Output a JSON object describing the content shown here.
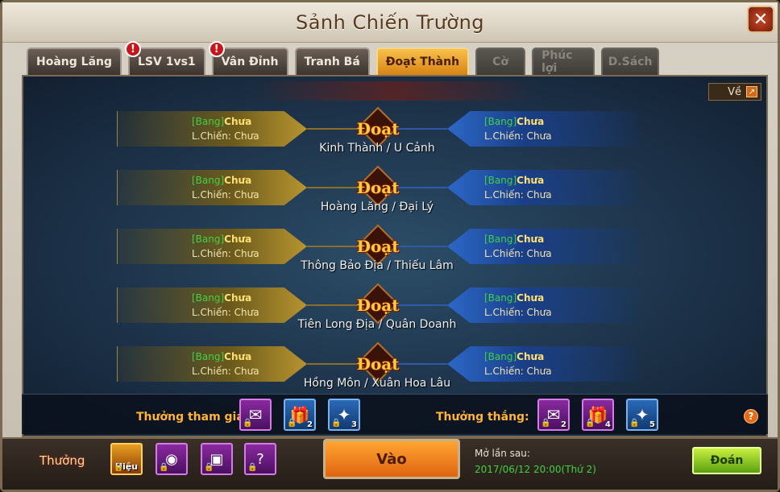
{
  "window": {
    "title": "Sảnh Chiến Trường",
    "close_glyph": "✕"
  },
  "tabs": [
    {
      "label": "Hoàng Lăng",
      "alert": false,
      "state": "normal"
    },
    {
      "label": "LSV 1vs1",
      "alert": true,
      "state": "normal"
    },
    {
      "label": "Vân Đỉnh",
      "alert": true,
      "state": "normal"
    },
    {
      "label": "Tranh Bá",
      "alert": false,
      "state": "normal"
    },
    {
      "label": "Đoạt Thành",
      "alert": false,
      "state": "active"
    },
    {
      "label": "Cờ",
      "alert": false,
      "state": "disabled"
    },
    {
      "label": "Phúc lợi",
      "alert": false,
      "state": "disabled"
    },
    {
      "label": "D.Sách",
      "alert": false,
      "state": "disabled"
    }
  ],
  "alert_glyph": "!",
  "back_button": {
    "label": "Về",
    "icon": "back-arrow-icon",
    "glyph": "↗"
  },
  "doat_label": "Đoạt",
  "side_text": {
    "bang": "[Bang]",
    "chua": "Chưa",
    "lchien": "L.Chiến: Chưa"
  },
  "matches": [
    {
      "title": "Kinh Thành / U Cảnh"
    },
    {
      "title": "Hoàng Lăng / Đại Lý"
    },
    {
      "title": "Thông Bảo Địa / Thiếu Lâm"
    },
    {
      "title": "Tiên Long Địa / Quân Doanh"
    },
    {
      "title": "Hồng Môn / Xuân Hoa Lâu"
    }
  ],
  "rewards": {
    "participate_label": "Thưởng tham gia:",
    "win_label": "Thưởng thắng:",
    "participate_items": [
      {
        "icon": "token-icon",
        "count": ""
      },
      {
        "icon": "gift-box-icon",
        "count": "2"
      },
      {
        "icon": "scroll-icon",
        "count": "3"
      }
    ],
    "win_items": [
      {
        "icon": "token-icon",
        "count": "2"
      },
      {
        "icon": "gift-box-icon",
        "count": "4"
      },
      {
        "icon": "scroll-icon",
        "count": "5"
      }
    ],
    "help_glyph": "?"
  },
  "bottom": {
    "thuong_label": "Thưởng",
    "hieu_label": "Hiệu",
    "vao_label": "Vào",
    "next_open_label": "Mở lần sau:",
    "next_open_time": "2017/06/12 20:00(Thứ 2)",
    "doan_label": "Đoán"
  },
  "colors": {
    "accent_orange": "#e06410",
    "bang_green": "#3fd23f",
    "chua_yellow": "#ffe070"
  }
}
